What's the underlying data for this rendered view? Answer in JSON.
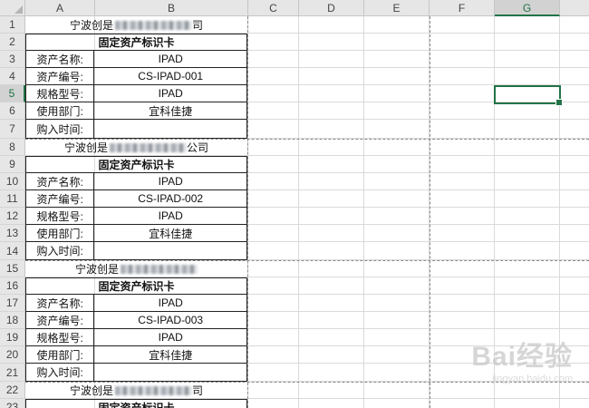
{
  "columns": [
    "A",
    "B",
    "C",
    "D",
    "E",
    "F",
    "G"
  ],
  "selected_column": "G",
  "rows": [
    "1",
    "2",
    "3",
    "4",
    "5",
    "6",
    "7",
    "8",
    "9",
    "10",
    "11",
    "12",
    "13",
    "14",
    "15",
    "16",
    "17",
    "18",
    "19",
    "20",
    "21",
    "22",
    "23"
  ],
  "selected_row": "5",
  "cards": [
    {
      "company_prefix": "宁波创是",
      "company_suffix": "司",
      "title": "固定资产标识卡",
      "fields": [
        {
          "label": "资产名称:",
          "value": "IPAD"
        },
        {
          "label": "资产编号:",
          "value": "CS-IPAD-001"
        },
        {
          "label": "规格型号:",
          "value": "IPAD"
        },
        {
          "label": "使用部门:",
          "value": "宜科佳捷"
        },
        {
          "label": "购入时间:",
          "value": ""
        }
      ]
    },
    {
      "company_prefix": "宁波创是",
      "company_suffix": "公司",
      "title": "固定资产标识卡",
      "fields": [
        {
          "label": "资产名称:",
          "value": "IPAD"
        },
        {
          "label": "资产编号:",
          "value": "CS-IPAD-002"
        },
        {
          "label": "规格型号:",
          "value": "IPAD"
        },
        {
          "label": "使用部门:",
          "value": "宜科佳捷"
        },
        {
          "label": "购入时间:",
          "value": ""
        }
      ]
    },
    {
      "company_prefix": "宁波创是",
      "company_suffix": "",
      "title": "固定资产标识卡",
      "fields": [
        {
          "label": "资产名称:",
          "value": "IPAD"
        },
        {
          "label": "资产编号:",
          "value": "CS-IPAD-003"
        },
        {
          "label": "规格型号:",
          "value": "IPAD"
        },
        {
          "label": "使用部门:",
          "value": "宜科佳捷"
        },
        {
          "label": "购入时间:",
          "value": ""
        }
      ]
    },
    {
      "company_prefix": "宁波创是",
      "company_suffix": "司",
      "title": "固定资产标识卡",
      "fields": []
    }
  ],
  "watermark": {
    "brand": "Bai",
    "brand2": "经验",
    "sub": "jingyan.baidu.com"
  },
  "colors": {
    "accent": "#217346",
    "header_bg": "#e6e6e6",
    "gridline": "#dadada"
  }
}
